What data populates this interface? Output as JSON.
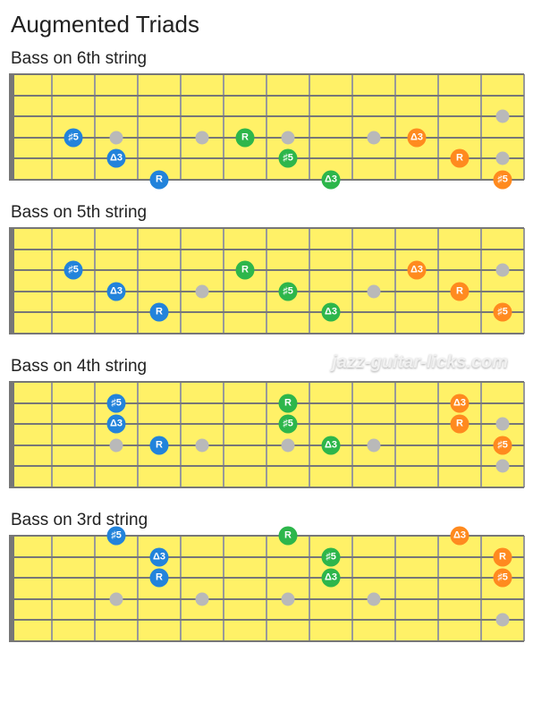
{
  "title": "Augmented Triads",
  "watermark": "jazz-guitar-licks.com",
  "noteLabels": {
    "R": "R",
    "M3": "Δ3",
    "S5": "♯5"
  },
  "colors": {
    "blue": "#2283db",
    "green": "#2db64b",
    "orange": "#ff8a1f"
  },
  "fretboard": {
    "frets": 12,
    "strings": 6,
    "markerFrets": [
      3,
      5,
      7,
      9,
      12
    ]
  },
  "diagrams": [
    {
      "title": "Bass on 6th string",
      "markerString": 4,
      "notes": [
        {
          "string": 4,
          "fret": 2,
          "label": "S5",
          "color": "blue"
        },
        {
          "string": 5,
          "fret": 3,
          "label": "M3",
          "color": "blue"
        },
        {
          "string": 6,
          "fret": 4,
          "label": "R",
          "color": "blue"
        },
        {
          "string": 4,
          "fret": 6,
          "label": "R",
          "color": "green"
        },
        {
          "string": 5,
          "fret": 7,
          "label": "S5",
          "color": "green"
        },
        {
          "string": 6,
          "fret": 8,
          "label": "M3",
          "color": "green"
        },
        {
          "string": 4,
          "fret": 10,
          "label": "M3",
          "color": "orange"
        },
        {
          "string": 5,
          "fret": 11,
          "label": "R",
          "color": "orange"
        },
        {
          "string": 6,
          "fret": 12,
          "label": "S5",
          "color": "orange"
        }
      ]
    },
    {
      "title": "Bass on 5th string",
      "markerString": 4,
      "notes": [
        {
          "string": 3,
          "fret": 2,
          "label": "S5",
          "color": "blue"
        },
        {
          "string": 4,
          "fret": 3,
          "label": "M3",
          "color": "blue"
        },
        {
          "string": 5,
          "fret": 4,
          "label": "R",
          "color": "blue"
        },
        {
          "string": 3,
          "fret": 6,
          "label": "R",
          "color": "green"
        },
        {
          "string": 4,
          "fret": 7,
          "label": "S5",
          "color": "green"
        },
        {
          "string": 5,
          "fret": 8,
          "label": "M3",
          "color": "green"
        },
        {
          "string": 3,
          "fret": 10,
          "label": "M3",
          "color": "orange"
        },
        {
          "string": 4,
          "fret": 11,
          "label": "R",
          "color": "orange"
        },
        {
          "string": 5,
          "fret": 12,
          "label": "S5",
          "color": "orange"
        }
      ]
    },
    {
      "title": "Bass on 4th string",
      "markerString": 4,
      "notes": [
        {
          "string": 2,
          "fret": 3,
          "label": "S5",
          "color": "blue"
        },
        {
          "string": 3,
          "fret": 3,
          "label": "M3",
          "color": "blue"
        },
        {
          "string": 4,
          "fret": 4,
          "label": "R",
          "color": "blue"
        },
        {
          "string": 2,
          "fret": 7,
          "label": "R",
          "color": "green"
        },
        {
          "string": 3,
          "fret": 7,
          "label": "S5",
          "color": "green"
        },
        {
          "string": 4,
          "fret": 8,
          "label": "M3",
          "color": "green"
        },
        {
          "string": 2,
          "fret": 11,
          "label": "M3",
          "color": "orange"
        },
        {
          "string": 3,
          "fret": 11,
          "label": "R",
          "color": "orange"
        },
        {
          "string": 4,
          "fret": 12,
          "label": "S5",
          "color": "orange"
        }
      ]
    },
    {
      "title": "Bass on 3rd string",
      "markerString": 4,
      "notes": [
        {
          "string": 1,
          "fret": 3,
          "label": "S5",
          "color": "blue"
        },
        {
          "string": 2,
          "fret": 4,
          "label": "M3",
          "color": "blue"
        },
        {
          "string": 3,
          "fret": 4,
          "label": "R",
          "color": "blue"
        },
        {
          "string": 1,
          "fret": 7,
          "label": "R",
          "color": "green"
        },
        {
          "string": 2,
          "fret": 8,
          "label": "S5",
          "color": "green"
        },
        {
          "string": 3,
          "fret": 8,
          "label": "M3",
          "color": "green"
        },
        {
          "string": 1,
          "fret": 11,
          "label": "M3",
          "color": "orange"
        },
        {
          "string": 2,
          "fret": 12,
          "label": "R",
          "color": "orange"
        },
        {
          "string": 3,
          "fret": 12,
          "label": "S5",
          "color": "orange"
        }
      ]
    }
  ]
}
